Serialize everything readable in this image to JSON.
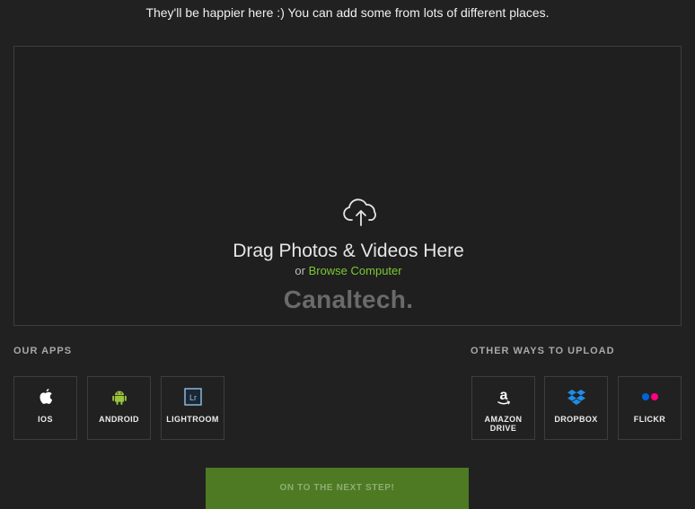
{
  "intro_text": "They'll be happier here :) You can add some from lots of different places.",
  "dropzone": {
    "icon": "cloud-upload-icon",
    "title": "Drag Photos & Videos Here",
    "or_text": "or",
    "browse_label": "Browse Computer",
    "watermark": "Canaltech."
  },
  "our_apps": {
    "label": "OUR APPS",
    "items": [
      {
        "label": "IOS",
        "icon": "apple-icon"
      },
      {
        "label": "ANDROID",
        "icon": "android-icon"
      },
      {
        "label": "LIGHTROOM",
        "icon": "lightroom-icon"
      }
    ]
  },
  "other_ways": {
    "label": "OTHER WAYS TO UPLOAD",
    "items": [
      {
        "label": "AMAZON DRIVE",
        "icon": "amazon-icon"
      },
      {
        "label": "DROPBOX",
        "icon": "dropbox-icon"
      },
      {
        "label": "FLICKR",
        "icon": "flickr-icon"
      }
    ]
  },
  "next_button": "ON TO THE NEXT STEP!",
  "colors": {
    "background": "#212121",
    "accent_green": "#7cc832",
    "button_green": "#4e7a23",
    "dropbox_blue": "#1f8ce6",
    "flickr_blue": "#0063dc",
    "flickr_pink": "#ff0084"
  }
}
